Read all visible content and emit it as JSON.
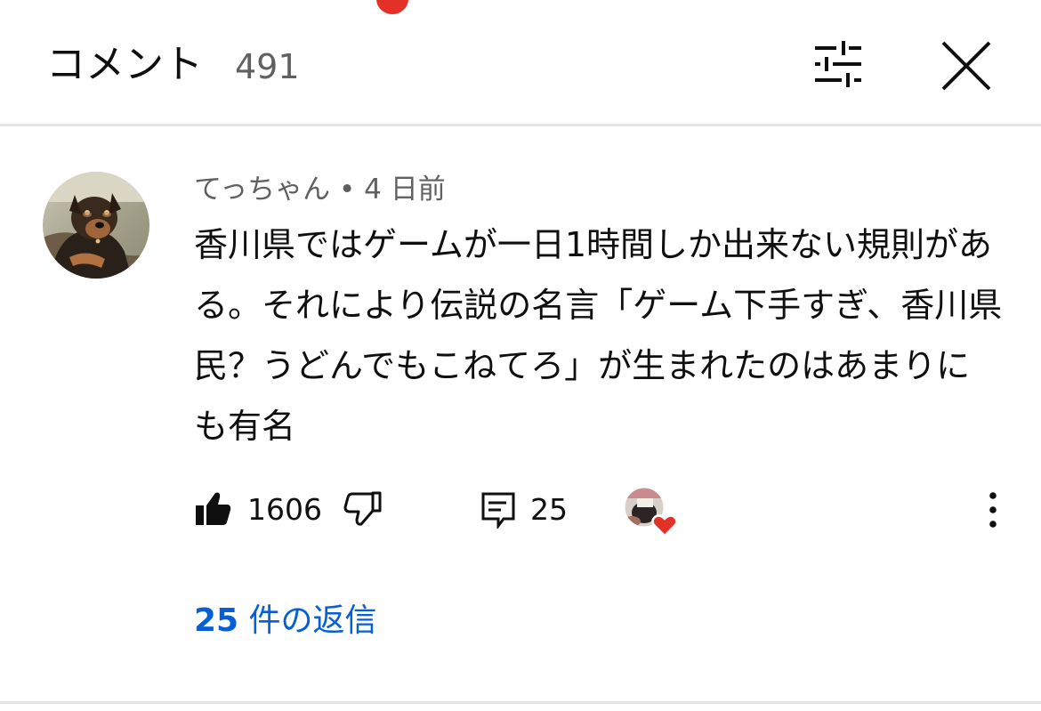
{
  "header": {
    "title": "コメント",
    "count": "491",
    "filter_icon": "sliders-icon",
    "close_icon": "close-icon"
  },
  "comment": {
    "author": "てっちゃん",
    "separator": " • ",
    "time": "4 日前",
    "text": "香川県ではゲームが一日1時間しか出来ない規則がある。それにより伝説の名言「ゲーム下手すぎ、香川県民？うどんでもこねてろ」が生まれたのはあまりにも有名",
    "like_count": "1606",
    "reply_count": "25",
    "creator_heart": true
  },
  "replies": {
    "count": "25",
    "label": " 件の返信"
  },
  "colors": {
    "link": "#065fd4",
    "heart": "#e33128",
    "divider": "#e5e5e5",
    "secondary_text": "#606060"
  }
}
